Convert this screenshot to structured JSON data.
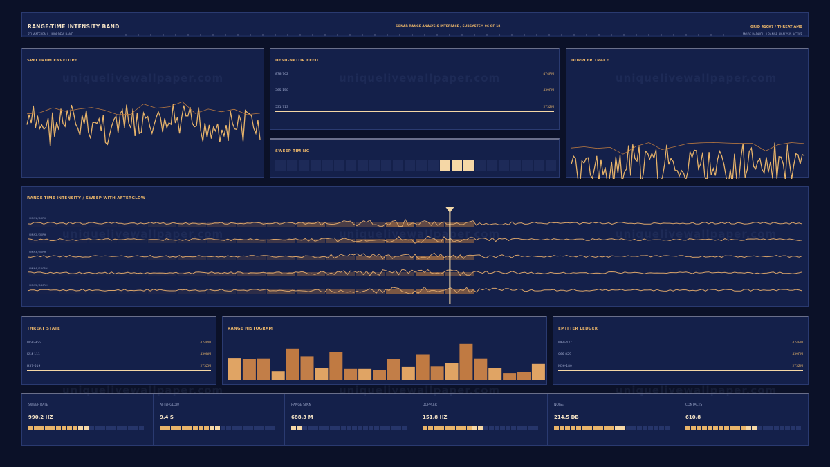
{
  "header": {
    "title": "RANGE-TIME INTENSITY BAND",
    "subtitle": "RTI WATERFALL / MORDEW BAND",
    "center_text": "SONAR RANGE ANALYSIS INTERFACE / SUBSYSTEM 06 OF 18",
    "right_text": "GRID 410K7 / THREAT AMB",
    "right_subtext": "MODE RADHOLL / RANGE ANALYSIS ACTIVE"
  },
  "watermark": "uniquelivewallpaper.com",
  "spectrum": {
    "title": "SPECTRUM ENVELOPE"
  },
  "designator": {
    "title": "DESIGNATOR FEED",
    "rows": [
      {
        "label": "878-762",
        "value": "474RM"
      },
      {
        "label": "365-158",
        "value": "439RM"
      },
      {
        "label": "531-713",
        "value": "273ZM"
      }
    ]
  },
  "doppler": {
    "title": "DOPPLER TRACE"
  },
  "sweep_timing": {
    "title": "SWEEP TIMING",
    "cell_count": 24,
    "active_cells": [
      14,
      15,
      16
    ]
  },
  "rti": {
    "title": "RANGE-TIME INTENSITY / SWEEP WITH AFTERGLOW",
    "tracks": [
      {
        "label": "SM-N1 / 10RH"
      },
      {
        "label": "SM-N2 / 30RH"
      },
      {
        "label": "SM-N3 / 50RH"
      },
      {
        "label": "SM-N4 / 120RH"
      },
      {
        "label": "SM-N5 / 160RH"
      }
    ],
    "sweep_position": 0.545
  },
  "threat": {
    "title": "THREAT STATE",
    "rows": [
      {
        "label": "M68-955",
        "value": "474RM"
      },
      {
        "label": "K54-111",
        "value": "439RM"
      },
      {
        "label": "H57-519",
        "value": "273ZM"
      }
    ]
  },
  "histogram": {
    "title": "RANGE HISTOGRAM",
    "values": [
      0.55,
      0.52,
      0.54,
      0.22,
      0.78,
      0.58,
      0.3,
      0.7,
      0.28,
      0.28,
      0.25,
      0.52,
      0.33,
      0.63,
      0.34,
      0.42,
      0.9,
      0.54,
      0.3,
      0.17,
      0.2,
      0.4
    ]
  },
  "emitter": {
    "title": "EMITTER LEDGER",
    "rows": [
      {
        "label": "M60-437",
        "value": "474RM"
      },
      {
        "label": "066-829",
        "value": "439RM"
      },
      {
        "label": "M56-180",
        "value": "273ZM"
      }
    ]
  },
  "metrics": [
    {
      "label": "SWEEP RATE",
      "value": "990.2 HZ",
      "fill": 0.52
    },
    {
      "label": "AFTERGLOW",
      "value": "9.4 S",
      "fill": 0.52
    },
    {
      "label": "RANGE SPAN",
      "value": "688.3 M",
      "fill": 0.1
    },
    {
      "label": "DOPPLER",
      "value": "151.8 HZ",
      "fill": 0.52
    },
    {
      "label": "NOISE",
      "value": "214.5 DB",
      "fill": 0.62
    },
    {
      "label": "CONTACTS",
      "value": "610.8",
      "fill": 0.62
    }
  ],
  "colors": {
    "accent": "#e8b46a",
    "accent_dark": "#b87840",
    "bright": "#f5d7a6",
    "panel": "#14204a",
    "background": "#0b1128"
  }
}
